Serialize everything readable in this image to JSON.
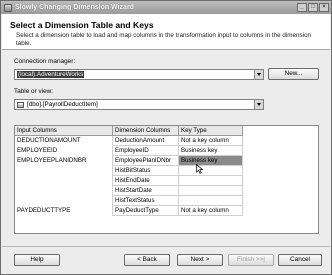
{
  "window": {
    "title": "Slowly Changing Dimension Wizard",
    "controls": [
      "_",
      "□",
      "×"
    ]
  },
  "header": {
    "title": "Select a Dimension Table and Keys",
    "description": "Select a dimension table to load and map columns in the transformation input to columns in the dimension table."
  },
  "connection": {
    "label": "Connection manager:",
    "value": "(local).AdventureWorks",
    "new_button": "New..."
  },
  "table_view": {
    "label": "Table or view:",
    "value": "[dbo].[PayrollDeductItem]"
  },
  "grid": {
    "columns": [
      "Input Columns",
      "Dimension Columns",
      "Key Type"
    ],
    "rows": [
      {
        "input": "DEDUCTIONAMOUNT",
        "dimension": "DeductionAmount",
        "key": "Not a key column"
      },
      {
        "input": "EMPLOYEEID",
        "dimension": "EmployeeID",
        "key": "Business key"
      },
      {
        "input": "EMPLOYEEPLANIDNBR",
        "dimension": "EmployeePlanIDNbr",
        "key": "Business key"
      },
      {
        "input": "",
        "dimension": "HistBitStatus",
        "key": ""
      },
      {
        "input": "",
        "dimension": "HistEndDate",
        "key": ""
      },
      {
        "input": "",
        "dimension": "HistStartDate",
        "key": ""
      },
      {
        "input": "",
        "dimension": "HistTextStatus",
        "key": ""
      },
      {
        "input": "PAYDEDUCTTYPE",
        "dimension": "PayDeductType",
        "key": "Not a key column"
      }
    ]
  },
  "footer": {
    "help": "Help",
    "back": "< Back",
    "next": "Next >",
    "finish": "Finish >>|",
    "cancel": "Cancel"
  },
  "colors": {
    "selected_highlight": "#3a3a3a",
    "cell_highlight": "#8a8a8a"
  }
}
